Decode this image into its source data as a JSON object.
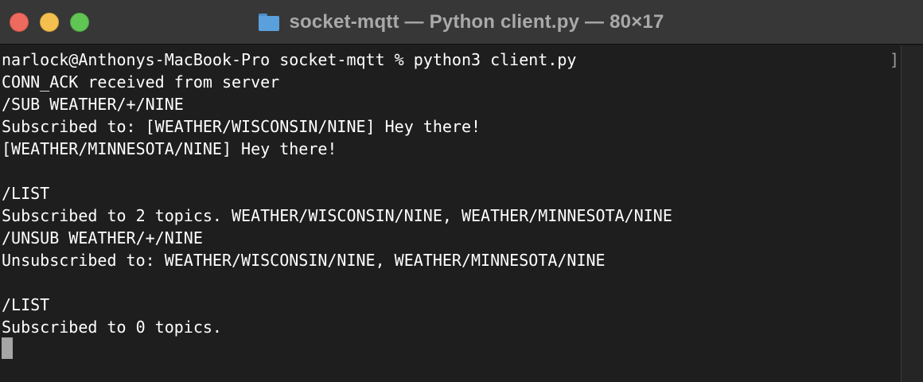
{
  "window": {
    "title": "socket-mqtt — Python client.py — 80×17",
    "folder_icon": "folder-icon"
  },
  "colors": {
    "background": "#1e1e1e",
    "titlebar": "#373737",
    "text": "#ffffff",
    "close": "#ed6a5e",
    "minimize": "#f4bf4f",
    "zoom": "#61c554"
  },
  "terminal": {
    "lines": [
      "narlock@Anthonys-MacBook-Pro socket-mqtt % python3 client.py",
      "CONN_ACK received from server",
      "/SUB WEATHER/+/NINE",
      "Subscribed to: [WEATHER/WISCONSIN/NINE] Hey there!",
      "[WEATHER/MINNESOTA/NINE] Hey there!",
      "",
      "/LIST",
      "Subscribed to 2 topics. WEATHER/WISCONSIN/NINE, WEATHER/MINNESOTA/NINE",
      "/UNSUB WEATHER/+/NINE",
      "Unsubscribed to: WEATHER/WISCONSIN/NINE, WEATHER/MINNESOTA/NINE",
      "",
      "/LIST",
      "Subscribed to 0 topics."
    ],
    "scroll_marker": "]"
  }
}
